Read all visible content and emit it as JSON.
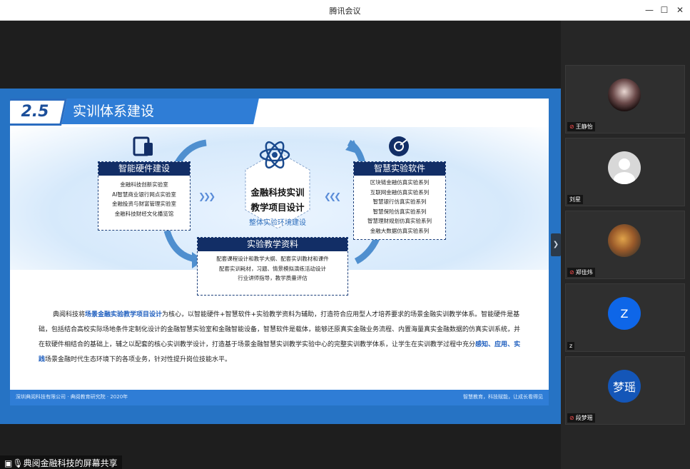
{
  "window": {
    "title": "腾讯会议",
    "minimize_icon": "—",
    "maximize_icon": "☐",
    "close_icon": "✕"
  },
  "slide": {
    "number": "2.5",
    "title": "实训体系建设",
    "left_box": {
      "heading": "智能硬件建设",
      "items": [
        "金融科技创新实验室",
        "AI智慧商业银行网点实验室",
        "金融投资与财富管理实验室",
        "金融科技财经文化播览馆"
      ]
    },
    "right_box": {
      "heading": "智慧实验软件",
      "items": [
        "区块链金融仿真实验系列",
        "互联网金融仿真实验系列",
        "智慧银行仿真实验系列",
        "智慧保险仿真实验系列",
        "智慧理财规划仿真实验系列",
        "金融大数据仿真实验系列"
      ]
    },
    "center": {
      "line1": "金融科技实训",
      "line2": "教学项目设计",
      "subtitle": "整体实验环境建设"
    },
    "bottom_box": {
      "heading": "实验教学资料",
      "items": [
        "配套课程设计和教学大纲、配套实训教材和课件",
        "配套实训耗材，习题、情景模拟演练活动设计",
        "行业讲师指导，教学质量评估"
      ]
    },
    "paragraph": {
      "p1": "典阅科技将",
      "h1": "场景金融实验教学项目设计",
      "p2": "为核心，以智能硬件+智慧软件+实验教学资料为辅助，打造符合应用型人才培养要求的场景金融实训教学体系。智能硬件是基础，包括结合高校实际场地条件定制化设计的金融智慧实验室和金融智能设备，智慧软件是载体，能够还原真实金融业务流程、内置海量真实金融数据的仿真实训系统，并在软硬件相结合的基础上，辅之以配套的核心实训教学设计，打造基于场景金融智慧实训教学实验中心的完整实训教学体系，让学生在实训教学过程中充分",
      "h2": "感知",
      "sep1": "、",
      "h3": "应用",
      "sep2": "、",
      "h4": "实践",
      "p3": "场景金融时代生态环境下的各项业务，针对性提升岗位技能水平。"
    },
    "footer_left": "深圳典阅科技有限公司 · 典阅教育研究院 · 2020年",
    "footer_right": "智慧教育，科技赋能，让成长看得见"
  },
  "share_label": "典阅金融科技的屏幕共享",
  "participants": [
    {
      "name": "王静怡",
      "avatar": "photo-dark",
      "muted": true
    },
    {
      "name": "刘星",
      "avatar": "default-person",
      "muted": false
    },
    {
      "name": "郑佳炜",
      "avatar": "photo-painting",
      "muted": true
    },
    {
      "name": "Z",
      "avatar_text": "Z",
      "label": "z",
      "muted": false
    },
    {
      "name": "段梦瑶",
      "avatar_text": "梦瑶",
      "muted": true
    }
  ],
  "colors": {
    "accent": "#2f7dd6",
    "box_header": "#122e66",
    "avatar_blue": "#0e66e8"
  }
}
